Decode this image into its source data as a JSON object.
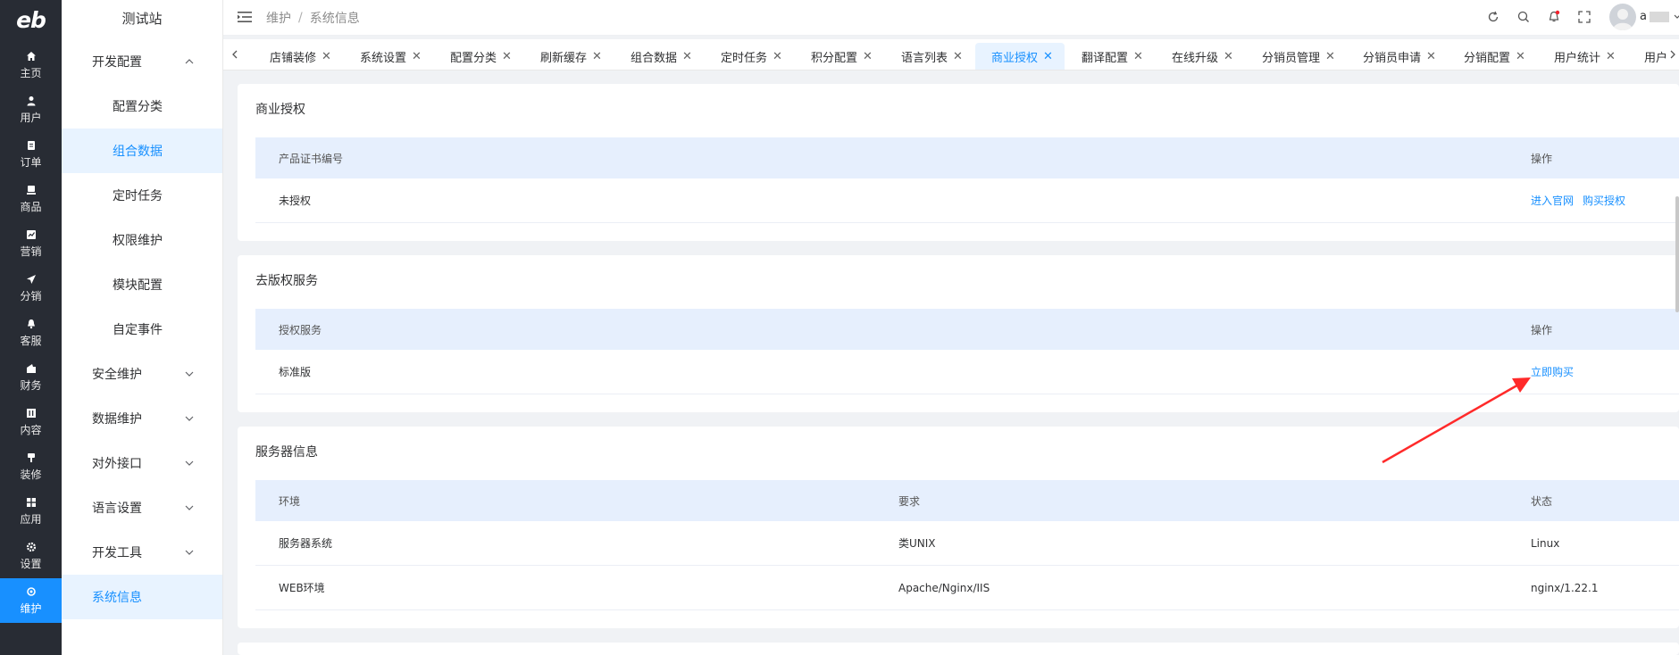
{
  "rail": {
    "logo": "eb",
    "items": [
      {
        "label": "主页",
        "icon": "home-icon"
      },
      {
        "label": "用户",
        "icon": "user-icon"
      },
      {
        "label": "订单",
        "icon": "order-icon"
      },
      {
        "label": "商品",
        "icon": "product-icon"
      },
      {
        "label": "营销",
        "icon": "marketing-icon"
      },
      {
        "label": "分销",
        "icon": "send-icon"
      },
      {
        "label": "客服",
        "icon": "bell-icon"
      },
      {
        "label": "财务",
        "icon": "finance-icon"
      },
      {
        "label": "内容",
        "icon": "content-icon"
      },
      {
        "label": "装修",
        "icon": "brush-icon"
      },
      {
        "label": "应用",
        "icon": "apps-icon"
      },
      {
        "label": "设置",
        "icon": "gear-icon"
      },
      {
        "label": "维护",
        "icon": "maintenance-icon",
        "active": true
      }
    ]
  },
  "submenu": {
    "title": "测试站",
    "items": [
      {
        "label": "开发配置",
        "type": "group",
        "expanded": true
      },
      {
        "label": "配置分类",
        "type": "child"
      },
      {
        "label": "组合数据",
        "type": "child",
        "active": true
      },
      {
        "label": "定时任务",
        "type": "child"
      },
      {
        "label": "权限维护",
        "type": "child"
      },
      {
        "label": "模块配置",
        "type": "child"
      },
      {
        "label": "自定事件",
        "type": "child"
      },
      {
        "label": "安全维护",
        "type": "group"
      },
      {
        "label": "数据维护",
        "type": "group"
      },
      {
        "label": "对外接口",
        "type": "group"
      },
      {
        "label": "语言设置",
        "type": "group"
      },
      {
        "label": "开发工具",
        "type": "group"
      },
      {
        "label": "系统信息",
        "type": "leaf",
        "active": true
      }
    ]
  },
  "header": {
    "breadcrumb": [
      "维护",
      "系统信息"
    ],
    "breadcrumb_sep": "/",
    "username": "a"
  },
  "tabs": [
    {
      "label": "店铺装修"
    },
    {
      "label": "系统设置"
    },
    {
      "label": "配置分类"
    },
    {
      "label": "刷新缓存"
    },
    {
      "label": "组合数据"
    },
    {
      "label": "定时任务"
    },
    {
      "label": "积分配置"
    },
    {
      "label": "语言列表"
    },
    {
      "label": "商业授权",
      "active": true
    },
    {
      "label": "翻译配置"
    },
    {
      "label": "在线升级"
    },
    {
      "label": "分销员管理"
    },
    {
      "label": "分销员申请"
    },
    {
      "label": "分销配置"
    },
    {
      "label": "用户统计"
    },
    {
      "label": "用户"
    }
  ],
  "license": {
    "title": "商业授权",
    "col_cert": "产品证书编号",
    "col_action": "操作",
    "cert_value": "未授权",
    "link_site": "进入官网",
    "link_buy": "购买授权"
  },
  "copyright": {
    "title": "去版权服务",
    "col_service": "授权服务",
    "col_action": "操作",
    "service_value": "标准版",
    "link_buy_now": "立即购买"
  },
  "server": {
    "title": "服务器信息",
    "col_env": "环境",
    "col_req": "要求",
    "col_status": "状态",
    "rows": [
      {
        "env": "服务器系统",
        "req": "类UNIX",
        "status": "Linux"
      },
      {
        "env": "WEB环境",
        "req": "Apache/Nginx/IIS",
        "status": "nginx/1.22.1"
      }
    ]
  },
  "colors": {
    "accent": "#1890ff",
    "rail_bg": "#282c34",
    "table_header_bg": "#e6effd",
    "arrow": "#ff2a2a",
    "notify_dot": "#f5222d"
  }
}
